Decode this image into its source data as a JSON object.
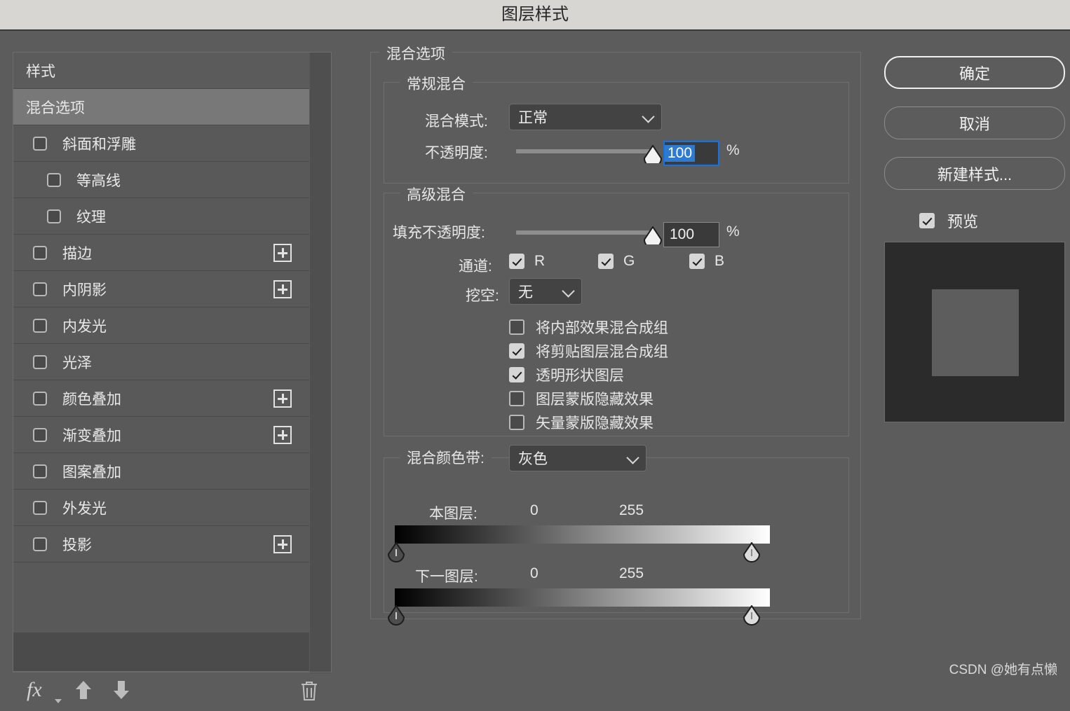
{
  "window": {
    "title": "图层样式"
  },
  "styles_panel": {
    "header_label": "样式",
    "items": [
      {
        "label": "混合选项",
        "selected": true,
        "has_checkbox": false,
        "checked": false,
        "indent": false,
        "has_plus": false
      },
      {
        "label": "斜面和浮雕",
        "selected": false,
        "has_checkbox": true,
        "checked": false,
        "indent": false,
        "has_plus": false
      },
      {
        "label": "等高线",
        "selected": false,
        "has_checkbox": true,
        "checked": false,
        "indent": true,
        "has_plus": false
      },
      {
        "label": "纹理",
        "selected": false,
        "has_checkbox": true,
        "checked": false,
        "indent": true,
        "has_plus": false
      },
      {
        "label": "描边",
        "selected": false,
        "has_checkbox": true,
        "checked": false,
        "indent": false,
        "has_plus": true
      },
      {
        "label": "内阴影",
        "selected": false,
        "has_checkbox": true,
        "checked": false,
        "indent": false,
        "has_plus": true
      },
      {
        "label": "内发光",
        "selected": false,
        "has_checkbox": true,
        "checked": false,
        "indent": false,
        "has_plus": false
      },
      {
        "label": "光泽",
        "selected": false,
        "has_checkbox": true,
        "checked": false,
        "indent": false,
        "has_plus": false
      },
      {
        "label": "颜色叠加",
        "selected": false,
        "has_checkbox": true,
        "checked": false,
        "indent": false,
        "has_plus": true
      },
      {
        "label": "渐变叠加",
        "selected": false,
        "has_checkbox": true,
        "checked": false,
        "indent": false,
        "has_plus": true
      },
      {
        "label": "图案叠加",
        "selected": false,
        "has_checkbox": true,
        "checked": false,
        "indent": false,
        "has_plus": false
      },
      {
        "label": "外发光",
        "selected": false,
        "has_checkbox": true,
        "checked": false,
        "indent": false,
        "has_plus": false
      },
      {
        "label": "投影",
        "selected": false,
        "has_checkbox": true,
        "checked": false,
        "indent": false,
        "has_plus": true
      }
    ],
    "toolbar": {
      "fx_label": "fx",
      "move_up_icon": "arrow-up-icon",
      "move_down_icon": "arrow-down-icon",
      "delete_icon": "trash-icon"
    }
  },
  "options": {
    "panel_title": "混合选项",
    "general": {
      "title": "常规混合",
      "blend_mode_label": "混合模式:",
      "blend_mode_value": "正常",
      "opacity_label": "不透明度:",
      "opacity_value": "100",
      "opacity_unit": "%",
      "opacity_percent": 100
    },
    "advanced": {
      "title": "高级混合",
      "fill_opacity_label": "填充不透明度:",
      "fill_opacity_value": "100",
      "fill_opacity_unit": "%",
      "fill_opacity_percent": 100,
      "channels_label": "通道:",
      "channels": [
        {
          "label": "R",
          "checked": true
        },
        {
          "label": "G",
          "checked": true
        },
        {
          "label": "B",
          "checked": true
        }
      ],
      "knockout_label": "挖空:",
      "knockout_value": "无",
      "checkboxes": [
        {
          "label": "将内部效果混合成组",
          "checked": false
        },
        {
          "label": "将剪贴图层混合成组",
          "checked": true
        },
        {
          "label": "透明形状图层",
          "checked": true
        },
        {
          "label": "图层蒙版隐藏效果",
          "checked": false
        },
        {
          "label": "矢量蒙版隐藏效果",
          "checked": false
        }
      ]
    },
    "blend_if": {
      "label": "混合颜色带:",
      "channel_value": "灰色",
      "this_layer": {
        "label": "本图层:",
        "black_value": "0",
        "white_value": "255"
      },
      "underlying_layer": {
        "label": "下一图层:",
        "black_value": "0",
        "white_value": "255"
      }
    }
  },
  "buttons": {
    "ok": "确定",
    "cancel": "取消",
    "new_style": "新建样式...",
    "preview_label": "预览",
    "preview_checked": true
  },
  "watermark": "CSDN @她有点懒",
  "colors": {
    "dialog_bg": "#5c5c5c",
    "titlebar_bg": "#d7d6d2",
    "row_bg": "#595959",
    "row_selected_bg": "#787878",
    "focus_blue": "#1473e6",
    "selection_blue": "#2f7ad1",
    "preview_bg": "#2b2b2b",
    "preview_square": "#5d5d5d"
  }
}
